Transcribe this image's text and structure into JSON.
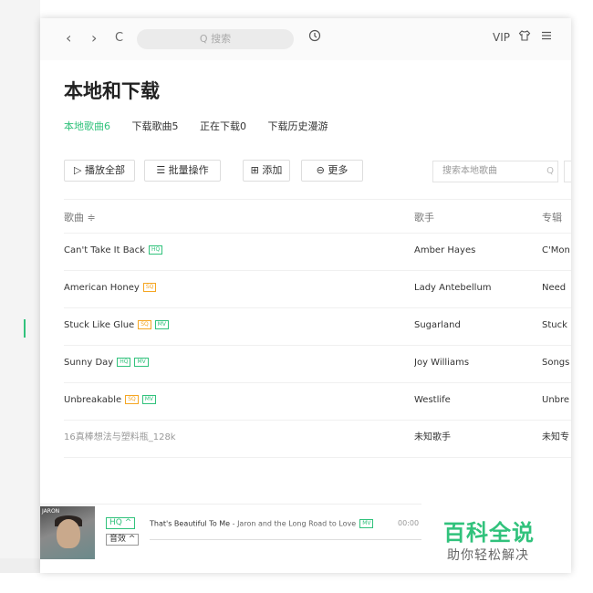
{
  "topbar": {
    "back": "‹",
    "forward": "›",
    "refresh": "C",
    "search_placeholder": "Q 搜索",
    "history_icon": "clock-icon",
    "vip": "VIP",
    "skin_icon": "shirt-icon",
    "menu_icon": "menu-icon",
    "accent": "#31c27c"
  },
  "page": {
    "title": "本地和下载",
    "tabs": [
      {
        "label": "本地歌曲6"
      },
      {
        "label": "下载歌曲5"
      },
      {
        "label": "正在下载0"
      },
      {
        "label": "下载历史漫游"
      }
    ]
  },
  "toolbar": {
    "play_all": "▷ 播放全部",
    "batch": "☰ 批量操作",
    "add": "⊞ 添加",
    "more": "⊖ 更多",
    "local_search_placeholder": "搜索本地歌曲",
    "search_icon": "Q"
  },
  "table": {
    "headers": {
      "song": "歌曲 ≑",
      "artist": "歌手",
      "album": "专辑"
    },
    "rows": [
      {
        "song": "Can't Take It Back",
        "badges": [
          "HQ"
        ],
        "artist": "Amber Hayes",
        "album": "C'Mon"
      },
      {
        "song": "American Honey",
        "badges": [
          "SQ"
        ],
        "artist": "Lady Antebellum",
        "album": "Need"
      },
      {
        "song": "Stuck Like Glue",
        "badges": [
          "SQ",
          "MV"
        ],
        "artist": "Sugarland",
        "album": "Stuck"
      },
      {
        "song": "Sunny Day",
        "badges": [
          "HQ",
          "MV"
        ],
        "artist": "Joy Williams",
        "album": "Songs"
      },
      {
        "song": "Unbreakable",
        "badges": [
          "SQ",
          "MV"
        ],
        "artist": "Westlife",
        "album": "Unbre"
      },
      {
        "song": "16真棒想法与塑料瓶_128k",
        "badges": [],
        "artist": "未知歌手",
        "album": "未知专"
      }
    ]
  },
  "player": {
    "cover_text": "JARON",
    "quality": "HQ ^",
    "effect": "音效 ^",
    "track": "That's Beautiful To Me",
    "artist": " - Jaron and the Long Road to Love",
    "mv": "MV",
    "time": "00:00"
  },
  "watermark": {
    "title": "百科全说",
    "subtitle": "助你轻松解决"
  }
}
